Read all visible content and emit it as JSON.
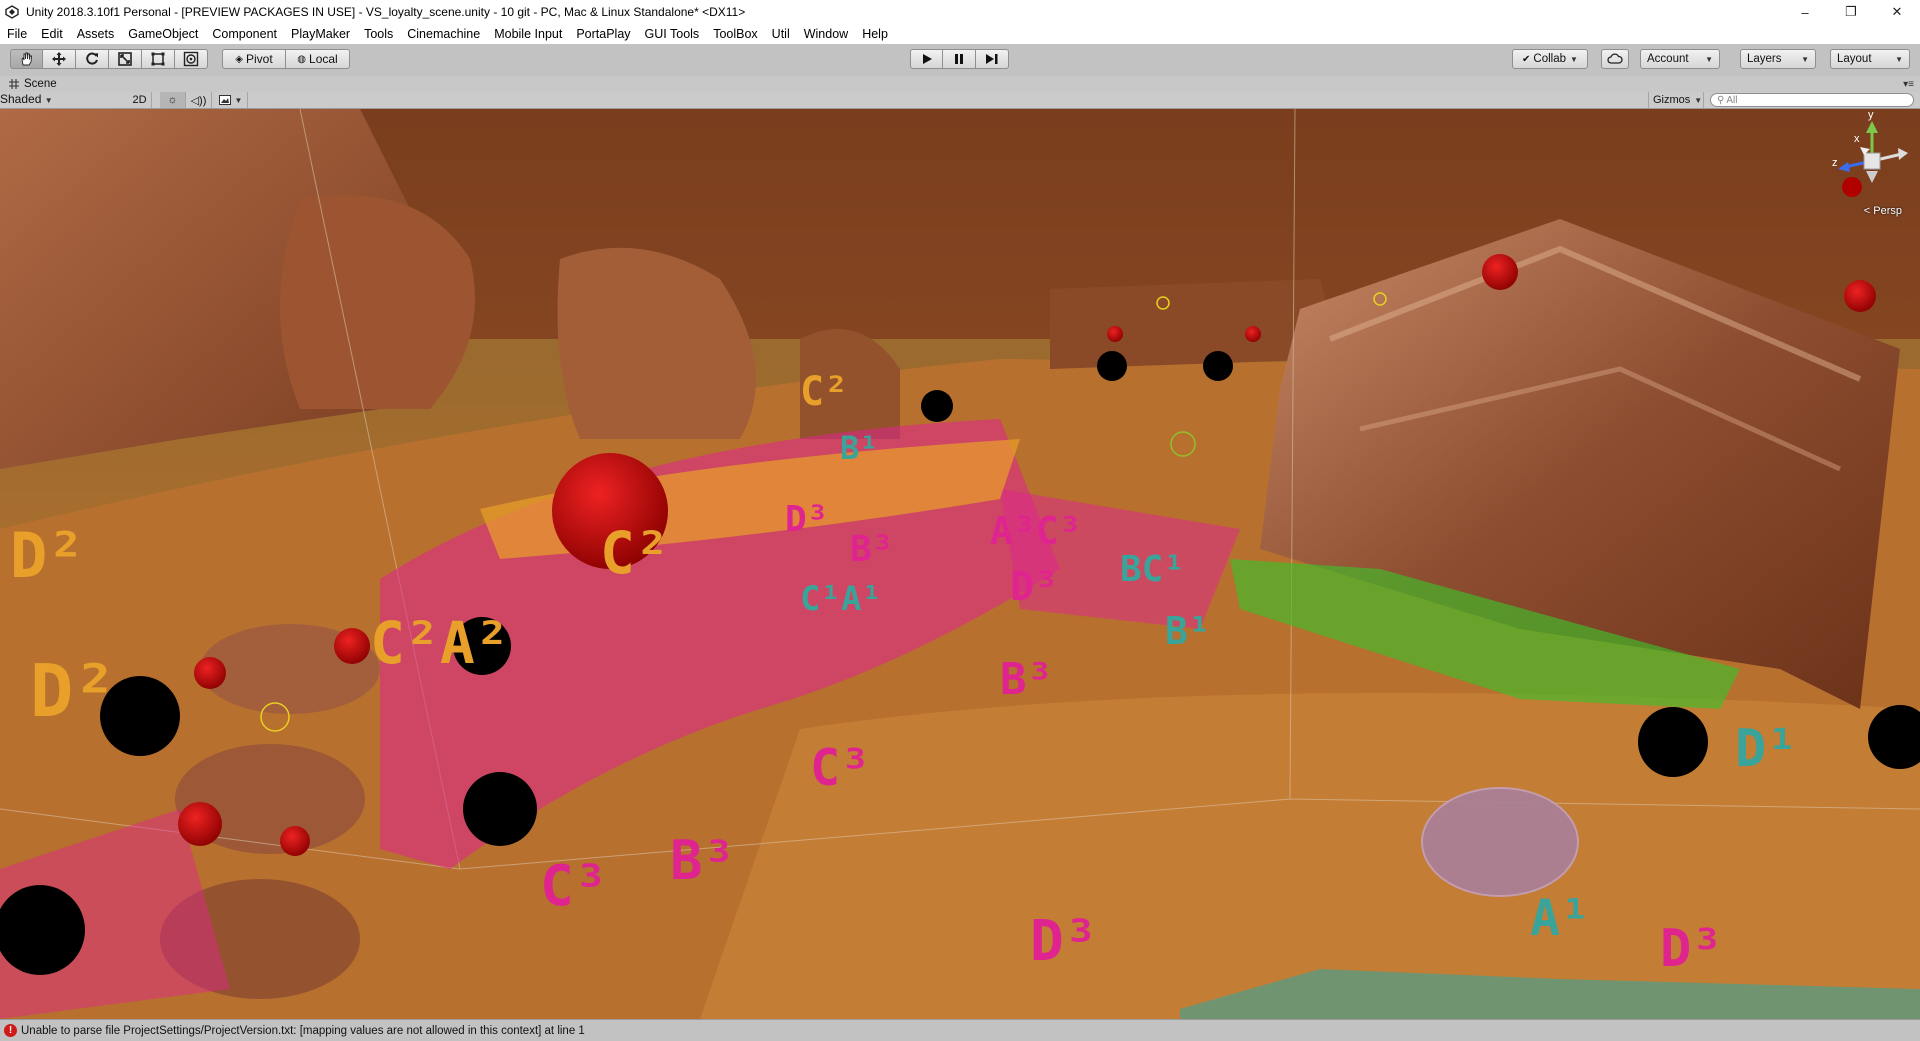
{
  "window": {
    "title": "Unity 2018.3.10f1 Personal - [PREVIEW PACKAGES IN USE] - VS_loyalty_scene.unity - 10 git - PC, Mac & Linux Standalone* <DX11>",
    "minimize_glyph": "–",
    "maximize_glyph": "❐",
    "close_glyph": "✕"
  },
  "menu": [
    "File",
    "Edit",
    "Assets",
    "GameObject",
    "Component",
    "PlayMaker",
    "Tools",
    "Cinemachine",
    "Mobile Input",
    "PortaPlay",
    "GUI Tools",
    "ToolBox",
    "Util",
    "Window",
    "Help"
  ],
  "toolbar": {
    "transform_tools": [
      "hand-tool-icon",
      "move-tool-icon",
      "rotate-tool-icon",
      "scale-tool-icon",
      "rect-tool-icon",
      "transform-tool-icon"
    ],
    "pivot_label": "Pivot",
    "local_label": "Local",
    "play_icons": [
      "play-icon",
      "pause-icon",
      "step-icon"
    ],
    "collab_label": "Collab",
    "account_label": "Account",
    "layers_label": "Layers",
    "layout_label": "Layout"
  },
  "scene_tab": {
    "label": "Scene"
  },
  "scene_options": {
    "shading_mode": "Shaded",
    "mode_2d": "2D",
    "gizmos_label": "Gizmos",
    "search_placeholder": "All"
  },
  "viewport": {
    "projection": "< Persp",
    "axis_labels": {
      "y": "y",
      "z": "z",
      "x": "x"
    },
    "floating_labels": [
      {
        "text": "D²",
        "color": "#e8a02a"
      },
      {
        "text": "D²",
        "color": "#e8a02a"
      },
      {
        "text": "C²",
        "color": "#e8a02a"
      },
      {
        "text": "C²A²",
        "color": "#e8a02a"
      },
      {
        "text": "C²",
        "color": "#e8a02a"
      },
      {
        "text": "B¹",
        "color": "#3aa39a"
      },
      {
        "text": "C¹A¹",
        "color": "#3aa39a"
      },
      {
        "text": "B¹",
        "color": "#3aa39a"
      },
      {
        "text": "BC¹",
        "color": "#3aa39a"
      },
      {
        "text": "D¹",
        "color": "#3aa39a"
      },
      {
        "text": "A¹",
        "color": "#3aa39a"
      },
      {
        "text": "D³",
        "color": "#e0248f"
      },
      {
        "text": "B³",
        "color": "#e0248f"
      },
      {
        "text": "C³",
        "color": "#e0248f"
      },
      {
        "text": "C³",
        "color": "#e0248f"
      },
      {
        "text": "B³",
        "color": "#e0248f"
      },
      {
        "text": "A³C³",
        "color": "#e0248f"
      },
      {
        "text": "D³",
        "color": "#e0248f"
      },
      {
        "text": "D³",
        "color": "#e0248f"
      },
      {
        "text": "B³",
        "color": "#e0248f"
      },
      {
        "text": "D³",
        "color": "#e0248f"
      }
    ]
  },
  "status": {
    "message": "Unable to parse file ProjectSettings/ProjectVersion.txt: [mapping values are not allowed in this context] at line 1"
  },
  "colors": {
    "label_orange": "#e8a02a",
    "label_pink": "#e0248f",
    "label_teal": "#3aa39a",
    "label_green": "#3fbf2a",
    "sphere_red": "#b00000",
    "ground": "#b8702e"
  }
}
